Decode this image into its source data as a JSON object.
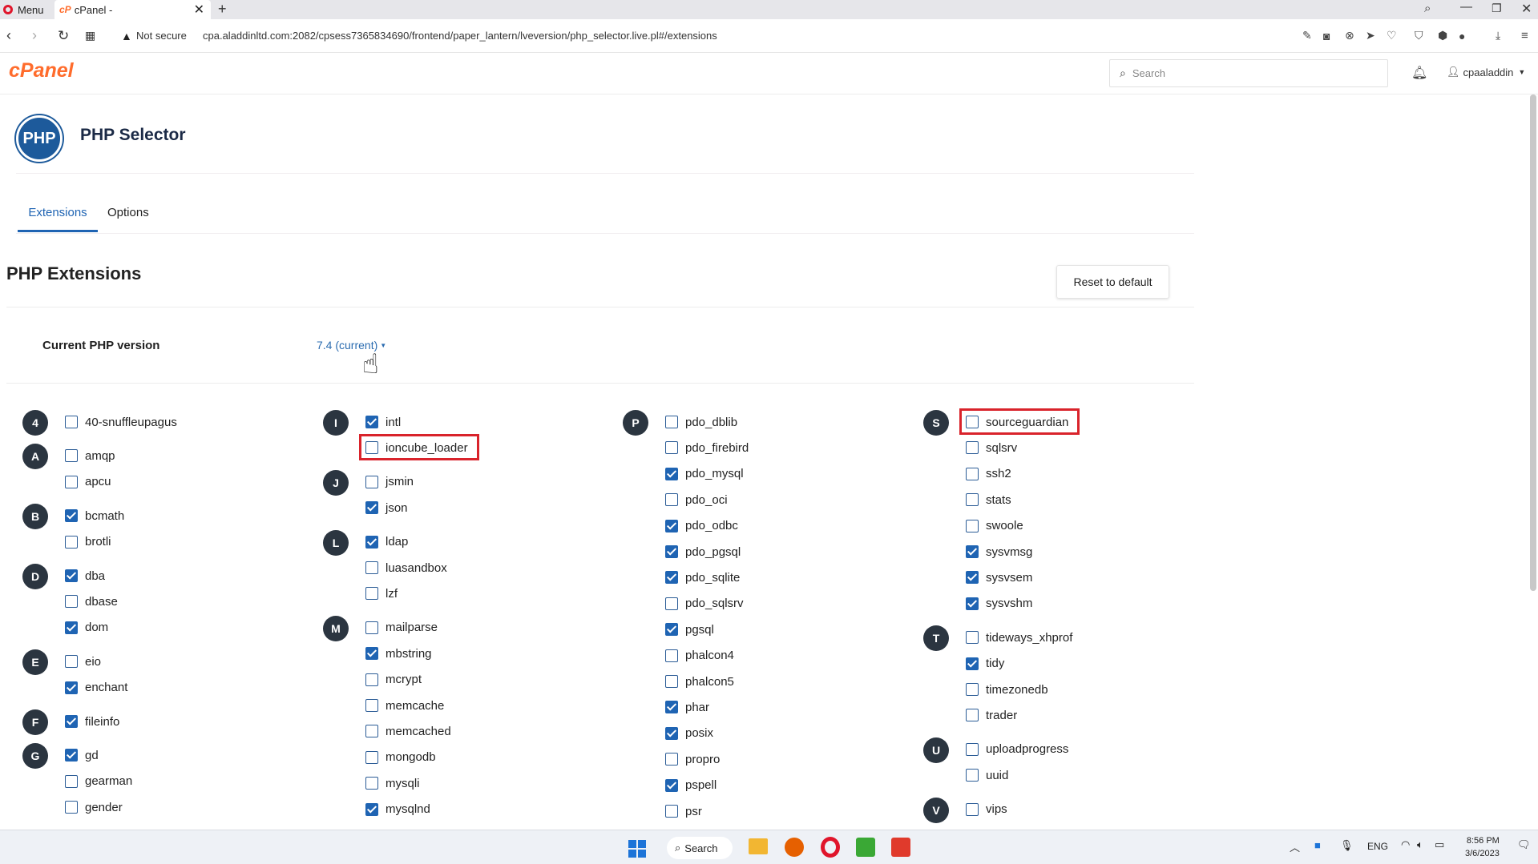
{
  "browser": {
    "menu_label": "Menu",
    "tab_title": "cPanel -",
    "security": "Not secure",
    "url": "cpa.aladdinltd.com:2082/cpsess7365834690/frontend/paper_lantern/lveversion/php_selector.live.pl#/extensions"
  },
  "header": {
    "logo": "cPanel",
    "search_placeholder": "Search",
    "username": "cpaaladdin"
  },
  "page": {
    "icon_text": "PHP",
    "title": "PHP Selector",
    "tabs": [
      "Extensions",
      "Options"
    ],
    "section_title": "PHP Extensions",
    "reset_label": "Reset to default",
    "version_label": "Current PHP version",
    "version_value": "7.4 (current)"
  },
  "columns": [
    {
      "groups": [
        {
          "letter": "4",
          "items": [
            {
              "name": "40-snuffleupagus",
              "checked": false
            }
          ]
        },
        {
          "letter": "A",
          "items": [
            {
              "name": "amqp",
              "checked": false
            },
            {
              "name": "apcu",
              "checked": false
            }
          ]
        },
        {
          "letter": "B",
          "items": [
            {
              "name": "bcmath",
              "checked": true
            },
            {
              "name": "brotli",
              "checked": false
            }
          ]
        },
        {
          "letter": "D",
          "items": [
            {
              "name": "dba",
              "checked": true
            },
            {
              "name": "dbase",
              "checked": false
            },
            {
              "name": "dom",
              "checked": true
            }
          ]
        },
        {
          "letter": "E",
          "items": [
            {
              "name": "eio",
              "checked": false
            },
            {
              "name": "enchant",
              "checked": true
            }
          ]
        },
        {
          "letter": "F",
          "items": [
            {
              "name": "fileinfo",
              "checked": true
            }
          ]
        },
        {
          "letter": "G",
          "items": [
            {
              "name": "gd",
              "checked": true
            },
            {
              "name": "gearman",
              "checked": false
            },
            {
              "name": "gender",
              "checked": false
            }
          ]
        }
      ]
    },
    {
      "groups": [
        {
          "letter": "I",
          "items": [
            {
              "name": "intl",
              "checked": true
            },
            {
              "name": "ioncube_loader",
              "checked": false,
              "highlight": true
            }
          ]
        },
        {
          "letter": "J",
          "items": [
            {
              "name": "jsmin",
              "checked": false
            },
            {
              "name": "json",
              "checked": true
            }
          ]
        },
        {
          "letter": "L",
          "items": [
            {
              "name": "ldap",
              "checked": true
            },
            {
              "name": "luasandbox",
              "checked": false
            },
            {
              "name": "lzf",
              "checked": false
            }
          ]
        },
        {
          "letter": "M",
          "items": [
            {
              "name": "mailparse",
              "checked": false
            },
            {
              "name": "mbstring",
              "checked": true
            },
            {
              "name": "mcrypt",
              "checked": false
            },
            {
              "name": "memcache",
              "checked": false
            },
            {
              "name": "memcached",
              "checked": false
            },
            {
              "name": "mongodb",
              "checked": false
            },
            {
              "name": "mysqli",
              "checked": false
            },
            {
              "name": "mysqlnd",
              "checked": true
            }
          ]
        }
      ]
    },
    {
      "groups": [
        {
          "letter": "P",
          "items": [
            {
              "name": "pdo_dblib",
              "checked": false
            },
            {
              "name": "pdo_firebird",
              "checked": false
            },
            {
              "name": "pdo_mysql",
              "checked": true
            },
            {
              "name": "pdo_oci",
              "checked": false
            },
            {
              "name": "pdo_odbc",
              "checked": true
            },
            {
              "name": "pdo_pgsql",
              "checked": true
            },
            {
              "name": "pdo_sqlite",
              "checked": true
            },
            {
              "name": "pdo_sqlsrv",
              "checked": false
            },
            {
              "name": "pgsql",
              "checked": true
            },
            {
              "name": "phalcon4",
              "checked": false
            },
            {
              "name": "phalcon5",
              "checked": false
            },
            {
              "name": "phar",
              "checked": true
            },
            {
              "name": "posix",
              "checked": true
            },
            {
              "name": "propro",
              "checked": false
            },
            {
              "name": "pspell",
              "checked": true
            },
            {
              "name": "psr",
              "checked": false
            }
          ]
        }
      ]
    },
    {
      "groups": [
        {
          "letter": "S",
          "items": [
            {
              "name": "sourceguardian",
              "checked": false,
              "highlight": true
            },
            {
              "name": "sqlsrv",
              "checked": false
            },
            {
              "name": "ssh2",
              "checked": false
            },
            {
              "name": "stats",
              "checked": false
            },
            {
              "name": "swoole",
              "checked": false
            },
            {
              "name": "sysvmsg",
              "checked": true
            },
            {
              "name": "sysvsem",
              "checked": true
            },
            {
              "name": "sysvshm",
              "checked": true
            }
          ]
        },
        {
          "letter": "T",
          "items": [
            {
              "name": "tideways_xhprof",
              "checked": false
            },
            {
              "name": "tidy",
              "checked": true
            },
            {
              "name": "timezonedb",
              "checked": false
            },
            {
              "name": "trader",
              "checked": false
            }
          ]
        },
        {
          "letter": "U",
          "items": [
            {
              "name": "uploadprogress",
              "checked": false
            },
            {
              "name": "uuid",
              "checked": false
            }
          ]
        },
        {
          "letter": "V",
          "items": [
            {
              "name": "vips",
              "checked": false
            }
          ]
        }
      ]
    }
  ],
  "taskbar": {
    "search_label": "Search",
    "lang": "ENG",
    "time": "8:56 PM",
    "date": "3/6/2023"
  },
  "colors": {
    "accent": "#1f64b3",
    "brand": "#ff6c2c",
    "highlight": "#d9232b",
    "badge": "#2b3540"
  }
}
